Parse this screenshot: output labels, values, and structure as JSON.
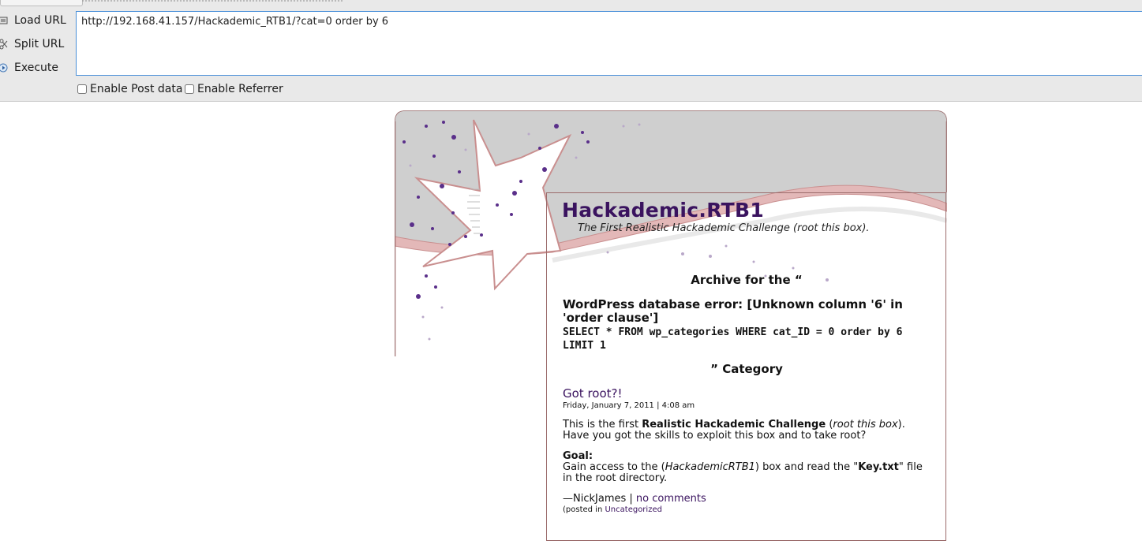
{
  "hackbar": {
    "buttons": {
      "load_url": "Load URL",
      "split_url": "Split URL",
      "execute": "Execute"
    },
    "url_value": "http://192.168.41.157/Hackademic_RTB1/?cat=0 order by 6",
    "checkboxes": {
      "post_data": "Enable Post data",
      "referrer": "Enable Referrer"
    }
  },
  "site": {
    "title": "Hackademic.RTB1",
    "tagline": "The First Realistic Hackademic Challenge (root this box)."
  },
  "archive": {
    "heading_start": "Archive for the “",
    "db_error": "WordPress database error: [Unknown column '6' in 'order clause']",
    "db_query": "SELECT * FROM wp_categories WHERE cat_ID = 0 order by 6 LIMIT 1",
    "heading_end": "” Category"
  },
  "post": {
    "title": "Got root?!",
    "date": "Friday, January 7, 2011 | 4:08 am",
    "intro_prefix": "This is the first ",
    "intro_bold": "Realistic Hackademic Challenge",
    "intro_mid": " (",
    "intro_italic": "root this box",
    "intro_suffix": ").",
    "intro_line2": "Have you got the skills to exploit this box and to take root?",
    "goal_label": "Goal:",
    "goal_prefix": "Gain access to the (",
    "goal_italic": "HackademicRTB1",
    "goal_mid": ") box and read the \"",
    "goal_bold": "Key.txt",
    "goal_suffix": "\" file in the root directory.",
    "author": "—NickJames | ",
    "comments_link": "no comments",
    "posted_in_prefix": "(posted in ",
    "category_link": "Uncategorized"
  },
  "colors": {
    "title_purple": "#3a135f",
    "accent_pink": "#d4a3a3",
    "url_border": "#4a90d9"
  }
}
